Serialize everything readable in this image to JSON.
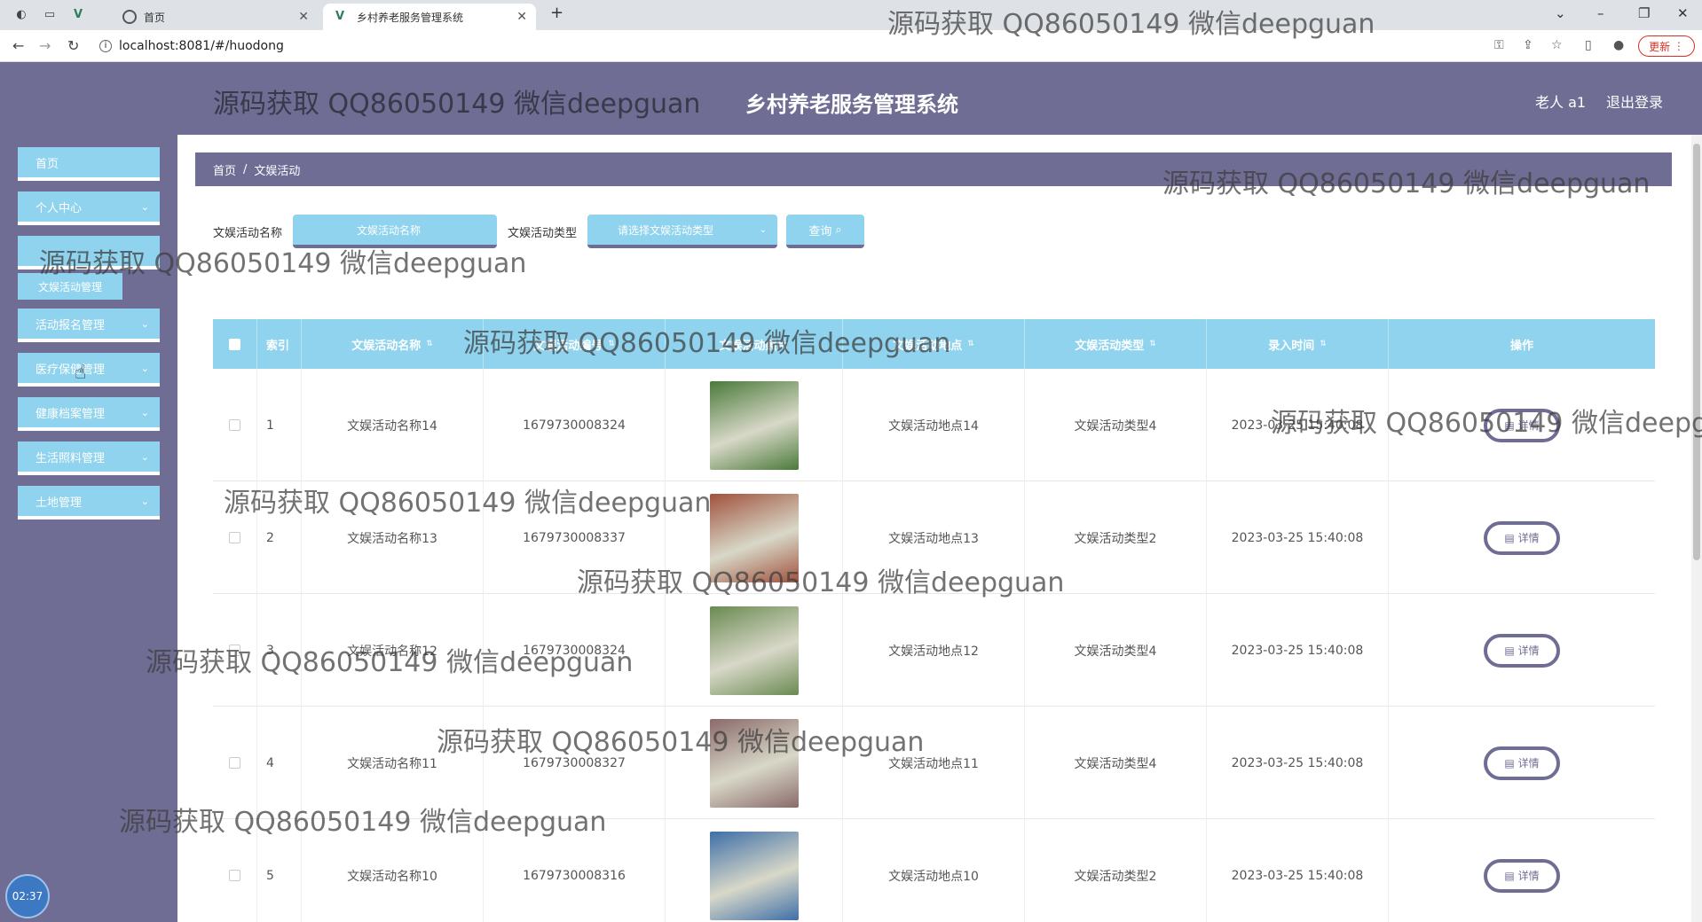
{
  "browser": {
    "tabs": [
      {
        "label": "首页"
      },
      {
        "label": "乡村养老服务管理系统"
      }
    ],
    "url": "localhost:8081/#/huodong",
    "update_label": "更新"
  },
  "header": {
    "title": "乡村养老服务管理系统",
    "user": "老人 a1",
    "logout": "退出登录"
  },
  "sidebar": {
    "items": [
      {
        "label": "首页",
        "has_arrow": false
      },
      {
        "label": "个人中心",
        "has_arrow": true
      },
      {
        "label": "",
        "has_arrow": false
      },
      {
        "label": "活动报名管理",
        "has_arrow": true
      },
      {
        "label": "医疗保健管理",
        "has_arrow": true
      },
      {
        "label": "健康档案管理",
        "has_arrow": true
      },
      {
        "label": "生活照料管理",
        "has_arrow": true
      },
      {
        "label": "土地管理",
        "has_arrow": true
      }
    ],
    "submenu": "文娱活动管理"
  },
  "clock": "02:37",
  "breadcrumb": {
    "home": "首页",
    "sep": "/",
    "current": "文娱活动"
  },
  "search": {
    "name_label": "文娱活动名称",
    "name_placeholder": "文娱活动名称",
    "type_label": "文娱活动类型",
    "type_placeholder": "请选择文娱活动类型",
    "button": "查询"
  },
  "table": {
    "columns": [
      "索引",
      "文娱活动名称",
      "文娱活动编号",
      "文娱活动照片",
      "文娱活动地点",
      "文娱活动类型",
      "录入时间",
      "操作"
    ],
    "detail_label": "详情",
    "rows": [
      {
        "index": "1",
        "name": "文娱活动名称14",
        "code": "1679730008324",
        "location": "文娱活动地点14",
        "type": "文娱活动类型4",
        "time": "2023-03-25 15:40:08",
        "img": "#4a7a3a"
      },
      {
        "index": "2",
        "name": "文娱活动名称13",
        "code": "1679730008337",
        "location": "文娱活动地点13",
        "type": "文娱活动类型2",
        "time": "2023-03-25 15:40:08",
        "img": "#a0523d"
      },
      {
        "index": "3",
        "name": "文娱活动名称12",
        "code": "1679730008324",
        "location": "文娱活动地点12",
        "type": "文娱活动类型4",
        "time": "2023-03-25 15:40:08",
        "img": "#6a8a52"
      },
      {
        "index": "4",
        "name": "文娱活动名称11",
        "code": "1679730008327",
        "location": "文娱活动地点11",
        "type": "文娱活动类型4",
        "time": "2023-03-25 15:40:08",
        "img": "#8a6a6a"
      },
      {
        "index": "5",
        "name": "文娱活动名称10",
        "code": "1679730008316",
        "location": "文娱活动地点10",
        "type": "文娱活动类型2",
        "time": "2023-03-25 15:40:08",
        "img": "#3f6fa8"
      }
    ]
  },
  "watermark": "源码获取 QQ86050149 微信deepguan",
  "colors": {
    "primary": "#6f6d93",
    "accent": "#8fd3ee"
  }
}
